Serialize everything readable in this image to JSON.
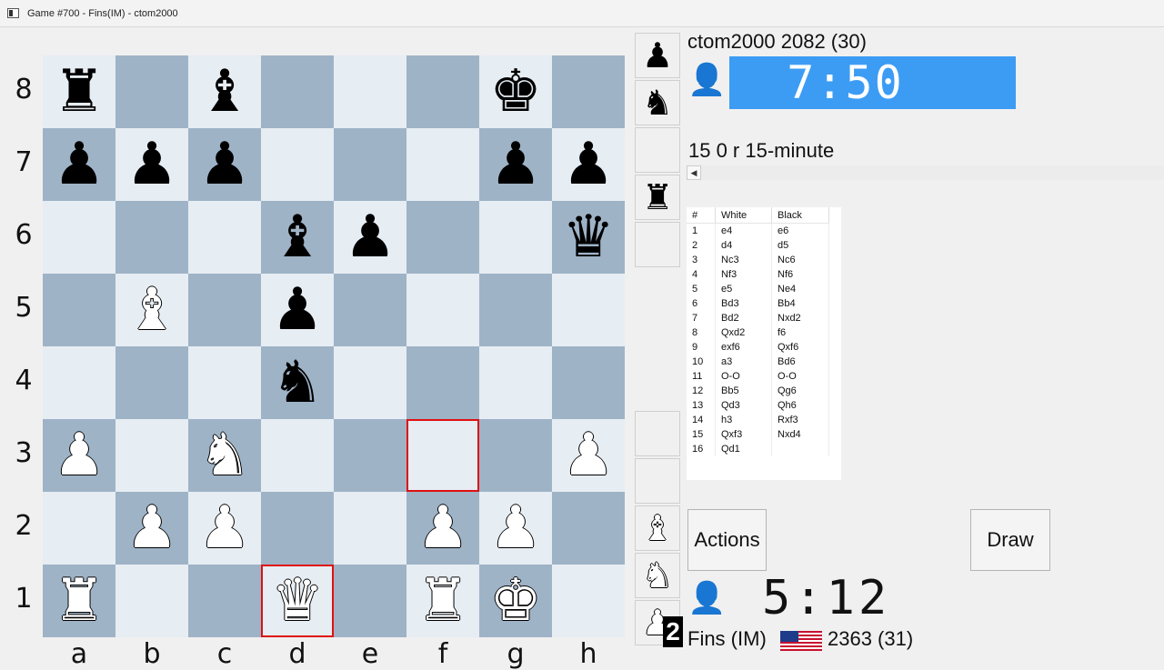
{
  "window": {
    "title": "Game #700 - Fins(IM) - ctom2000"
  },
  "board": {
    "ranks": [
      "8",
      "7",
      "6",
      "5",
      "4",
      "3",
      "2",
      "1"
    ],
    "files": [
      "a",
      "b",
      "c",
      "d",
      "e",
      "f",
      "g",
      "h"
    ],
    "colors": {
      "light": "#e6edf3",
      "dark": "#9fb3c7",
      "highlight": "#e01010"
    },
    "highlighted_squares": [
      "f3",
      "d1"
    ],
    "pieces": [
      {
        "square": "a8",
        "color": "black",
        "type": "rook",
        "glyph": "♜"
      },
      {
        "square": "c8",
        "color": "black",
        "type": "bishop",
        "glyph": "♝"
      },
      {
        "square": "g8",
        "color": "black",
        "type": "king",
        "glyph": "♚"
      },
      {
        "square": "a7",
        "color": "black",
        "type": "pawn",
        "glyph": "♟"
      },
      {
        "square": "b7",
        "color": "black",
        "type": "pawn",
        "glyph": "♟"
      },
      {
        "square": "c7",
        "color": "black",
        "type": "pawn",
        "glyph": "♟"
      },
      {
        "square": "g7",
        "color": "black",
        "type": "pawn",
        "glyph": "♟"
      },
      {
        "square": "h7",
        "color": "black",
        "type": "pawn",
        "glyph": "♟"
      },
      {
        "square": "d6",
        "color": "black",
        "type": "bishop",
        "glyph": "♝"
      },
      {
        "square": "e6",
        "color": "black",
        "type": "pawn",
        "glyph": "♟"
      },
      {
        "square": "h6",
        "color": "black",
        "type": "queen",
        "glyph": "♛"
      },
      {
        "square": "b5",
        "color": "white",
        "type": "bishop",
        "glyph": "♝"
      },
      {
        "square": "d5",
        "color": "black",
        "type": "pawn",
        "glyph": "♟"
      },
      {
        "square": "d4",
        "color": "black",
        "type": "knight",
        "glyph": "♞"
      },
      {
        "square": "a3",
        "color": "white",
        "type": "pawn",
        "glyph": "♟"
      },
      {
        "square": "c3",
        "color": "white",
        "type": "knight",
        "glyph": "♞"
      },
      {
        "square": "h3",
        "color": "white",
        "type": "pawn",
        "glyph": "♟"
      },
      {
        "square": "b2",
        "color": "white",
        "type": "pawn",
        "glyph": "♟"
      },
      {
        "square": "c2",
        "color": "white",
        "type": "pawn",
        "glyph": "♟"
      },
      {
        "square": "f2",
        "color": "white",
        "type": "pawn",
        "glyph": "♟"
      },
      {
        "square": "g2",
        "color": "white",
        "type": "pawn",
        "glyph": "♟"
      },
      {
        "square": "a1",
        "color": "white",
        "type": "rook",
        "glyph": "♜"
      },
      {
        "square": "d1",
        "color": "white",
        "type": "queen",
        "glyph": "♛"
      },
      {
        "square": "f1",
        "color": "white",
        "type": "rook",
        "glyph": "♜"
      },
      {
        "square": "g1",
        "color": "white",
        "type": "king",
        "glyph": "♚"
      }
    ]
  },
  "captured": {
    "top": [
      {
        "color": "black",
        "type": "pawn",
        "glyph": "♟"
      },
      {
        "color": "black",
        "type": "knight",
        "glyph": "♞"
      },
      {
        "color": "empty",
        "type": "",
        "glyph": ""
      },
      {
        "color": "black",
        "type": "rook",
        "glyph": "♜"
      },
      {
        "color": "empty",
        "type": "",
        "glyph": ""
      }
    ],
    "bottom": [
      {
        "color": "empty",
        "type": "",
        "glyph": ""
      },
      {
        "color": "empty",
        "type": "",
        "glyph": ""
      },
      {
        "color": "white",
        "type": "bishop",
        "glyph": "♝"
      },
      {
        "color": "white",
        "type": "knight",
        "glyph": "♞"
      },
      {
        "color": "white",
        "type": "pawn",
        "glyph": "♟"
      }
    ],
    "pawn_count_badge": "2"
  },
  "top_player": {
    "name": "ctom2000",
    "rating": "2082 (30)",
    "clock": "7:50",
    "avatar_icon": "person-unknown-icon"
  },
  "game_type": "15 0 r 15-minute",
  "moves": {
    "headers": [
      "#",
      "White",
      "Black"
    ],
    "rows": [
      [
        "1",
        "e4",
        "e6"
      ],
      [
        "2",
        "d4",
        "d5"
      ],
      [
        "3",
        "Nc3",
        "Nc6"
      ],
      [
        "4",
        "Nf3",
        "Nf6"
      ],
      [
        "5",
        "e5",
        "Ne4"
      ],
      [
        "6",
        "Bd3",
        "Bb4"
      ],
      [
        "7",
        "Bd2",
        "Nxd2"
      ],
      [
        "8",
        "Qxd2",
        "f6"
      ],
      [
        "9",
        "exf6",
        "Qxf6"
      ],
      [
        "10",
        "a3",
        "Bd6"
      ],
      [
        "11",
        "O-O",
        "O-O"
      ],
      [
        "12",
        "Bb5",
        "Qg6"
      ],
      [
        "13",
        "Qd3",
        "Qh6"
      ],
      [
        "14",
        "h3",
        "Rxf3"
      ],
      [
        "15",
        "Qxf3",
        "Nxd4"
      ],
      [
        "16",
        "Qd1",
        ""
      ]
    ]
  },
  "buttons": {
    "actions": "Actions",
    "draw": "Draw"
  },
  "bottom_player": {
    "name": "Fins (IM)",
    "rating": "2363 (31)",
    "clock": "5:12",
    "avatar_icon": "person-icon",
    "flag": "us-flag-icon"
  },
  "accent": "#3c9cf4"
}
